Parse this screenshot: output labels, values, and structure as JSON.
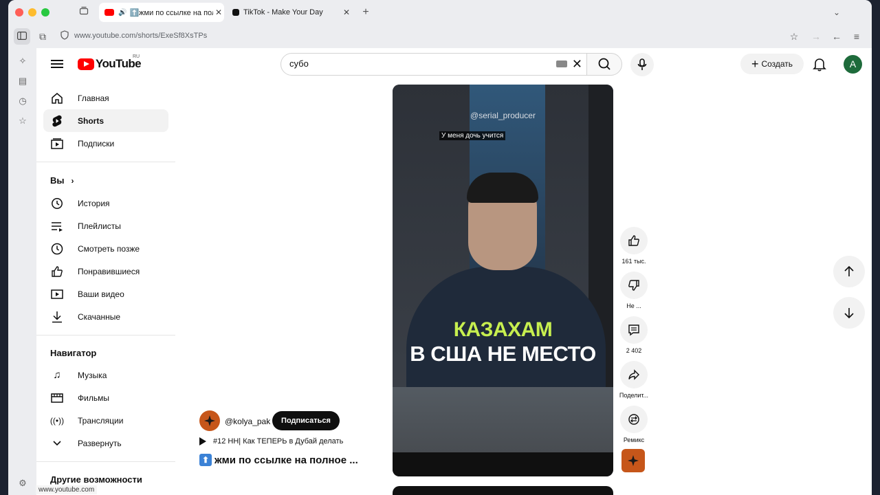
{
  "browser": {
    "tabs": [
      {
        "title": "⬆️жми по ссылке на полное ...",
        "active": true
      },
      {
        "title": "TikTok - Make Your Day",
        "active": false
      }
    ],
    "url": "www.youtube.com/shorts/ExeSf8XsTPs",
    "status_url": "www.youtube.com"
  },
  "youtube": {
    "logo_text": "YouTube",
    "country_code": "RU",
    "search": {
      "value": "субо"
    },
    "create_label": "Создать",
    "avatar_letter": "A"
  },
  "sidebar": {
    "primary": [
      {
        "label": "Главная",
        "icon": "home-icon"
      },
      {
        "label": "Shorts",
        "icon": "shorts-icon",
        "active": true
      },
      {
        "label": "Подписки",
        "icon": "subscriptions-icon"
      }
    ],
    "you_header": "Вы",
    "you_items": [
      {
        "label": "История",
        "icon": "history-icon"
      },
      {
        "label": "Плейлисты",
        "icon": "playlists-icon"
      },
      {
        "label": "Смотреть позже",
        "icon": "watch-later-icon"
      },
      {
        "label": "Понравившиеся",
        "icon": "like-icon"
      },
      {
        "label": "Ваши видео",
        "icon": "your-videos-icon"
      },
      {
        "label": "Скачанные",
        "icon": "download-icon"
      }
    ],
    "navigator_header": "Навигатор",
    "navigator_items": [
      {
        "label": "Музыка",
        "icon": "music-icon"
      },
      {
        "label": "Фильмы",
        "icon": "movies-icon"
      },
      {
        "label": "Трансляции",
        "icon": "live-icon"
      },
      {
        "label": "Развернуть",
        "icon": "chevron-down-icon"
      }
    ],
    "more_header": "Другие возможности"
  },
  "short": {
    "watermark": "@serial_producer",
    "subtitle": "У меня дочь учится",
    "caption_line1": "КАЗАХАМ",
    "caption_line2": "В США НЕ МЕСТО",
    "channel": "@kolya_pak",
    "subscribe_label": "Подписаться",
    "playlist": "#12 НН| Как ТЕПЕРЬ в Дубай делать",
    "title": "жми по ссылке на полное ...",
    "actions": {
      "likes": "161 тыс.",
      "dislike": "Не ...",
      "comments": "2 402",
      "share": "Поделит...",
      "remix": "Ремикс"
    }
  }
}
